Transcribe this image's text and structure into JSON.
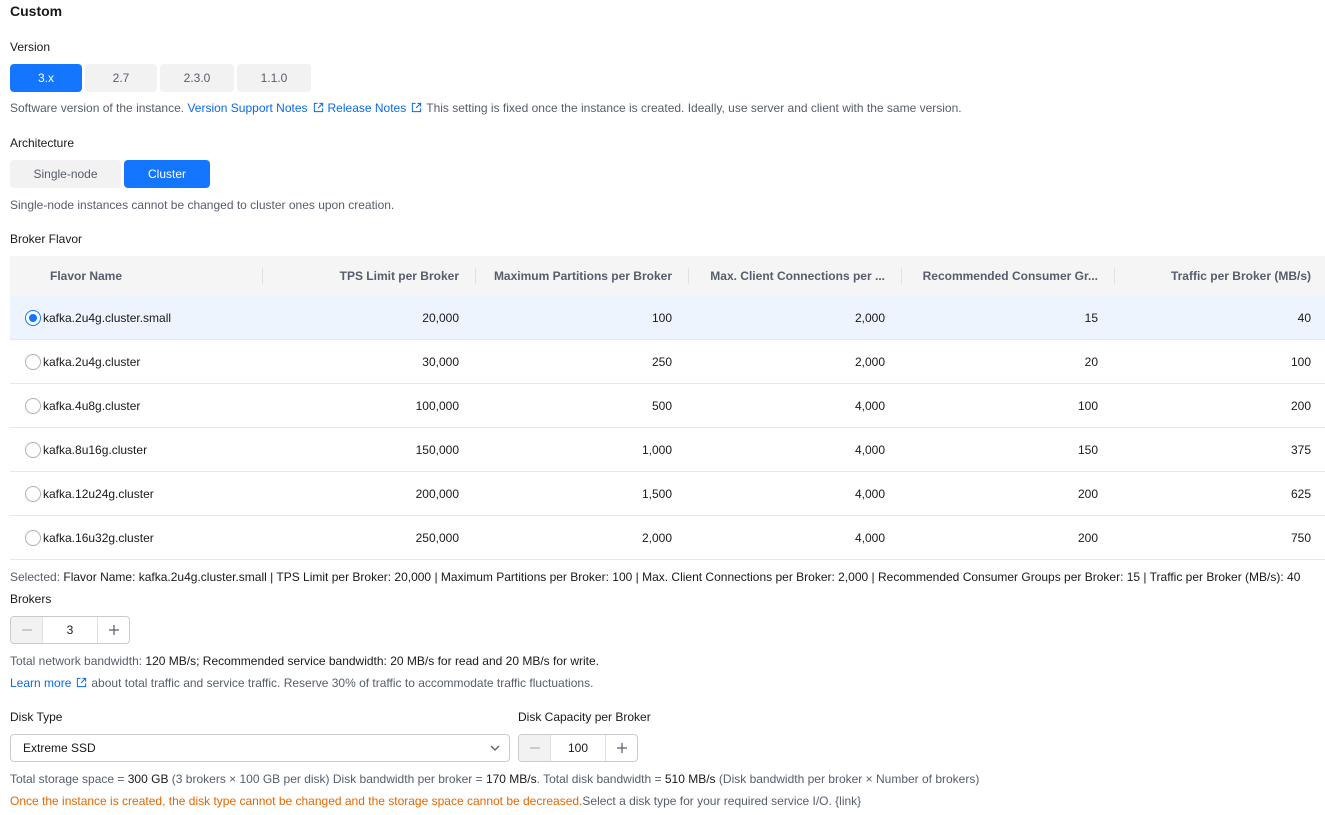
{
  "title": "Custom",
  "version": {
    "label": "Version",
    "options": [
      "3.x",
      "2.7",
      "2.3.0",
      "1.1.0"
    ],
    "selected": "3.x",
    "hint_prefix": "Software version of the instance.",
    "link_support": "Version Support Notes",
    "link_release": "Release Notes",
    "hint_suffix": "This setting is fixed once the instance is created. Ideally, use server and client with the same version."
  },
  "architecture": {
    "label": "Architecture",
    "options": [
      "Single-node",
      "Cluster"
    ],
    "selected": "Cluster",
    "hint": "Single-node instances cannot be changed to cluster ones upon creation."
  },
  "flavor": {
    "label": "Broker Flavor",
    "columns": [
      "Flavor Name",
      "TPS Limit per Broker",
      "Maximum Partitions per Broker",
      "Max. Client Connections per ...",
      "Recommended Consumer Gr...",
      "Traffic per Broker (MB/s)"
    ],
    "rows": [
      {
        "name": "kafka.2u4g.cluster.small",
        "tps": "20,000",
        "partitions": "100",
        "connections": "2,000",
        "groups": "15",
        "traffic": "40",
        "selected": true
      },
      {
        "name": "kafka.2u4g.cluster",
        "tps": "30,000",
        "partitions": "250",
        "connections": "2,000",
        "groups": "20",
        "traffic": "100",
        "selected": false
      },
      {
        "name": "kafka.4u8g.cluster",
        "tps": "100,000",
        "partitions": "500",
        "connections": "4,000",
        "groups": "100",
        "traffic": "200",
        "selected": false
      },
      {
        "name": "kafka.8u16g.cluster",
        "tps": "150,000",
        "partitions": "1,000",
        "connections": "4,000",
        "groups": "150",
        "traffic": "375",
        "selected": false
      },
      {
        "name": "kafka.12u24g.cluster",
        "tps": "200,000",
        "partitions": "1,500",
        "connections": "4,000",
        "groups": "200",
        "traffic": "625",
        "selected": false
      },
      {
        "name": "kafka.16u32g.cluster",
        "tps": "250,000",
        "partitions": "2,000",
        "connections": "4,000",
        "groups": "200",
        "traffic": "750",
        "selected": false
      }
    ],
    "selected_prefix": "Selected:",
    "selected_text": "Flavor Name: kafka.2u4g.cluster.small | TPS Limit per Broker: 20,000 | Maximum Partitions per Broker: 100 | Max. Client Connections per Broker: 2,000 | Recommended Consumer Groups per Broker: 15 | Traffic per Broker (MB/s): 40"
  },
  "brokers": {
    "label": "Brokers",
    "value": "3",
    "bw_prefix": "Total network bandwidth:",
    "bw_value": "120 MB/s;",
    "bw_rec_prefix": "Recommended service bandwidth:",
    "bw_rec_value": "20 MB/s for read and 20 MB/s for write.",
    "learn_more": "Learn more",
    "learn_suffix": "about total traffic and service traffic. Reserve 30% of traffic to accommodate traffic fluctuations."
  },
  "disk": {
    "type_label": "Disk Type",
    "type_value": "Extreme SSD",
    "capacity_label": "Disk Capacity per Broker",
    "capacity_value": "100",
    "s1": "Total storage space =",
    "s1v": "300 GB",
    "s2": "(3 brokers × 100 GB per disk) Disk bandwidth per broker =",
    "s2v": "170 MB/s",
    "s3": ". Total disk bandwidth =",
    "s3v": "510 MB/s",
    "s4": "(Disk bandwidth per broker × Number of brokers)",
    "warning": "Once the instance is created, the disk type cannot be changed and the storage space cannot be decreased.",
    "warning_suffix": "Select a disk type for your required service I/O. {link}"
  },
  "colors": {
    "primary": "#1476ff",
    "link": "#0a6ae8",
    "warning": "#e56600"
  }
}
